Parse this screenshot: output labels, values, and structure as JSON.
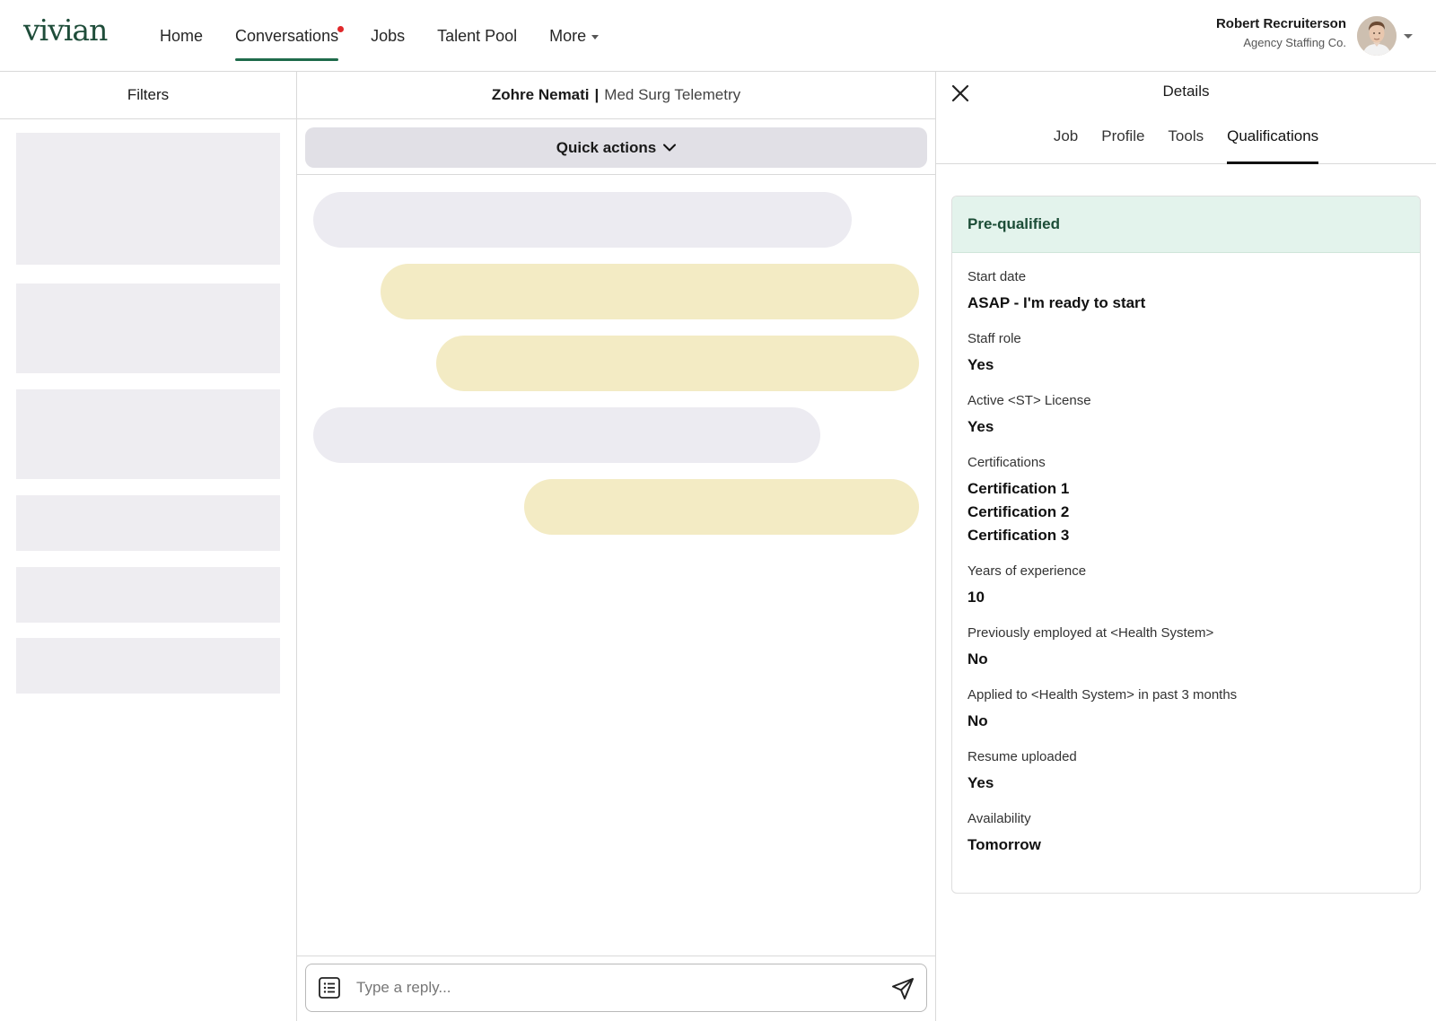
{
  "app": {
    "logo": "vivian"
  },
  "nav": {
    "items": [
      {
        "label": "Home"
      },
      {
        "label": "Conversations",
        "has_notification": true
      },
      {
        "label": "Jobs"
      },
      {
        "label": "Talent Pool"
      },
      {
        "label": "More"
      }
    ],
    "active": "Conversations"
  },
  "user": {
    "name": "Robert Recruiterson",
    "org": "Agency Staffing Co."
  },
  "filters": {
    "title": "Filters"
  },
  "chat": {
    "candidate_name": "Zohre Nemati",
    "separator": "|",
    "job_title": "Med Surg Telemetry",
    "quick_actions_label": "Quick actions",
    "reply_placeholder": "Type a reply..."
  },
  "details": {
    "title": "Details",
    "tabs": [
      "Job",
      "Profile",
      "Tools",
      "Qualifications"
    ],
    "active_tab": "Qualifications",
    "status": "Pre-qualified",
    "qualifications": [
      {
        "label": "Start date",
        "value": "ASAP - I'm ready to start"
      },
      {
        "label": "Staff role",
        "value": "Yes"
      },
      {
        "label": "Active <ST> License",
        "value": "Yes"
      },
      {
        "label": "Certifications",
        "values": [
          "Certification 1",
          "Certification 2",
          "Certification 3"
        ]
      },
      {
        "label": "Years of experience",
        "value": "10"
      },
      {
        "label": "Previously employed at <Health System>",
        "value": "No"
      },
      {
        "label": "Applied to <Health System> in past 3 months",
        "value": "No"
      },
      {
        "label": "Resume uploaded",
        "value": "Yes"
      },
      {
        "label": "Availability",
        "value": "Tomorrow"
      }
    ]
  },
  "colors": {
    "brand": "#1f4d3a",
    "nav_underline": "#1f6b4b",
    "notification": "#e0282a",
    "incoming_bubble": "#ecebf1",
    "outgoing_bubble": "#f3ebc4",
    "prequalified_bg": "#e3f3ec"
  }
}
